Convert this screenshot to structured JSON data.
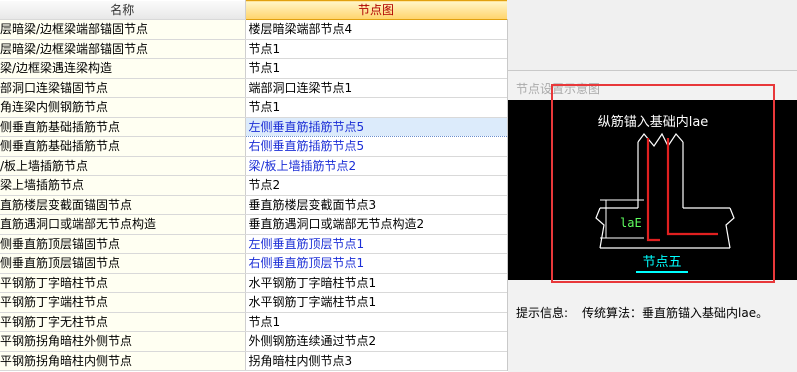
{
  "table": {
    "col_name": "名称",
    "col_node": "节点图",
    "rows": [
      {
        "name": "层暗梁/边框梁端部锚固节点",
        "node": "楼层暗梁端部节点4",
        "blue": false
      },
      {
        "name": "层暗梁/边框梁端部锚固节点",
        "node": "节点1",
        "blue": false
      },
      {
        "name": "梁/边框梁遇连梁构造",
        "node": "节点1",
        "blue": false
      },
      {
        "name": "部洞口连梁锚固节点",
        "node": "端部洞口连梁节点1",
        "blue": false
      },
      {
        "name": "角连梁内侧钢筋节点",
        "node": "节点1",
        "blue": false
      },
      {
        "name": "侧垂直筋基础插筋节点",
        "node": "左侧垂直筋插筋节点5",
        "blue": true,
        "selected": true
      },
      {
        "name": "侧垂直筋基础插筋节点",
        "node": "右侧垂直筋插筋节点5",
        "blue": true
      },
      {
        "name": "/板上墙插筋节点",
        "node": "梁/板上墙插筋节点2",
        "blue": true
      },
      {
        "name": "梁上墙插筋节点",
        "node": "节点2",
        "blue": false
      },
      {
        "name": "直筋楼层变截面锚固节点",
        "node": "垂直筋楼层变截面节点3",
        "blue": false
      },
      {
        "name": "直筋遇洞口或端部无节点构造",
        "node": "垂直筋遇洞口或端部无节点构造2",
        "blue": false
      },
      {
        "name": "侧垂直筋顶层锚固节点",
        "node": "左侧垂直筋顶层节点1",
        "blue": true
      },
      {
        "name": "侧垂直筋顶层锚固节点",
        "node": "右侧垂直筋顶层节点1",
        "blue": true
      },
      {
        "name": "平钢筋丁字暗柱节点",
        "node": "水平钢筋丁字暗柱节点1",
        "blue": false
      },
      {
        "name": "平钢筋丁字端柱节点",
        "node": "水平钢筋丁字端柱节点1",
        "blue": false
      },
      {
        "name": "平钢筋丁字无柱节点",
        "node": "节点1",
        "blue": false
      },
      {
        "name": "平钢筋拐角暗柱外侧节点",
        "node": "外侧钢筋连续通过节点2",
        "blue": false
      },
      {
        "name": "平钢筋拐角暗柱内侧节点",
        "node": "拐角暗柱内侧节点3",
        "blue": false
      }
    ]
  },
  "preview": {
    "title": "节点设置示意图",
    "diagram_title": "纵筋锚入基础内lae",
    "lab_label": "laE",
    "node_label": "节点五"
  },
  "hint": {
    "label": "提示信息:",
    "text": "传统算法：垂直筋锚入基础内lae。"
  },
  "colors": {
    "highlight_box": "#e8383a",
    "rebar_red": "#e02020",
    "dim_green": "#5fff5f",
    "node_cyan": "#00ffff",
    "link_blue": "#1c2fd6"
  }
}
